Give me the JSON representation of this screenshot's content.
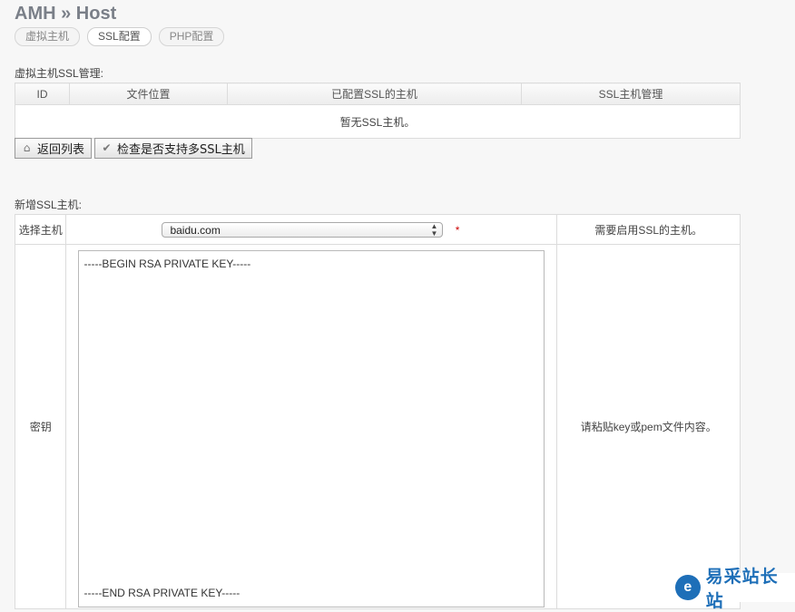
{
  "header": {
    "title": "AMH » Host"
  },
  "tabs": [
    {
      "label": "虚拟主机"
    },
    {
      "label": "SSL配置"
    },
    {
      "label": "PHP配置"
    }
  ],
  "ssl_list": {
    "section_title": "虚拟主机SSL管理:",
    "columns": [
      "ID",
      "文件位置",
      "已配置SSL的主机",
      "SSL主机管理"
    ],
    "empty_text": "暂无SSL主机。"
  },
  "buttons": {
    "back": "返回列表",
    "check": "检查是否支持多SSL主机"
  },
  "new_ssl": {
    "section_title": "新增SSL主机:",
    "host_label": "选择主机",
    "host_value": "baidu.com",
    "required_mark": "*",
    "host_hint": "需要启用SSL的主机。",
    "key_label": "密钥",
    "key_begin": "-----BEGIN RSA PRIVATE KEY-----",
    "key_end": "-----END RSA PRIVATE KEY-----",
    "key_hint": "请粘贴key或pem文件内容。"
  },
  "watermark": {
    "text": "易采站长站",
    "logo": "e"
  }
}
